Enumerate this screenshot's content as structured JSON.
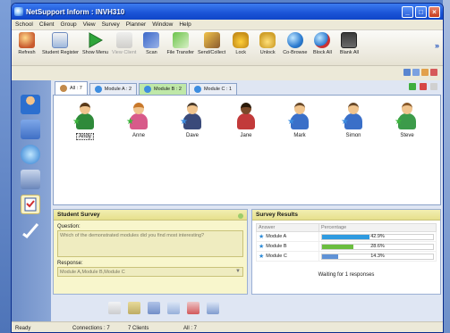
{
  "window": {
    "title": "NetSupport Inform : INVH310",
    "controls": {
      "minimize": "_",
      "maximize": "□",
      "close": "×"
    }
  },
  "menu": [
    "School",
    "Client",
    "Group",
    "View",
    "Survey",
    "Planner",
    "Window",
    "Help"
  ],
  "toolbar": {
    "buttons": [
      {
        "label": "Refresh",
        "icon": "refresh-icon",
        "disabled": false
      },
      {
        "label": "Student Register",
        "icon": "student-register-icon",
        "disabled": false
      },
      {
        "label": "Show Menu",
        "icon": "play-icon",
        "disabled": false
      },
      {
        "label": "View Client",
        "icon": "view-client-icon",
        "disabled": true
      },
      {
        "label": "Scan",
        "icon": "scan-icon",
        "disabled": false
      },
      {
        "label": "File Transfer",
        "icon": "file-transfer-icon",
        "disabled": false
      },
      {
        "label": "Send/Collect",
        "icon": "send-collect-icon",
        "disabled": false
      },
      {
        "label": "Lock",
        "icon": "lock-icon",
        "disabled": false
      },
      {
        "label": "Unlock",
        "icon": "unlock-icon",
        "disabled": false
      },
      {
        "label": "Co-Browse",
        "icon": "globe-icon",
        "disabled": false
      },
      {
        "label": "Block All",
        "icon": "block-all-icon",
        "disabled": false
      },
      {
        "label": "Blank All",
        "icon": "blank-all-icon",
        "disabled": false
      }
    ],
    "more": "»"
  },
  "tabs": [
    {
      "label": "All : 7",
      "active": true
    },
    {
      "label": "Module A : 2",
      "active": false
    },
    {
      "label": "Module B : 2",
      "active": false
    },
    {
      "label": "Module C : 1",
      "active": false
    }
  ],
  "students": [
    {
      "name": "Andy",
      "selected": true,
      "gender": "m"
    },
    {
      "name": "Anne",
      "selected": false,
      "gender": "f"
    },
    {
      "name": "Dave",
      "selected": false,
      "gender": "m"
    },
    {
      "name": "Jane",
      "selected": false,
      "gender": "f"
    },
    {
      "name": "Mark",
      "selected": false,
      "gender": "m"
    },
    {
      "name": "Simon",
      "selected": false,
      "gender": "m"
    },
    {
      "name": "Steve",
      "selected": false,
      "gender": "m"
    }
  ],
  "survey": {
    "title": "Student Survey",
    "question_label": "Question:",
    "question_text": "Which of the demonstrated modules did you find most interesting?",
    "response_label": "Response:",
    "response_value": "Module A,Module B,Module C"
  },
  "results": {
    "title": "Survey Results",
    "columns": [
      "Answer",
      "Percentage"
    ],
    "rows": [
      {
        "answer": "Module A",
        "percentage": "42.9%",
        "value": 42.9
      },
      {
        "answer": "Module B",
        "percentage": "28.6%",
        "value": 28.6
      },
      {
        "answer": "Module C",
        "percentage": "14.3%",
        "value": 14.3
      }
    ],
    "waiting": "Waiting for 1 responses"
  },
  "status": {
    "state": "Ready",
    "connections": "Connections : 7",
    "clients": "7 Clients",
    "all": "All : 7"
  },
  "colors": {
    "title_bar": "#1a53d6",
    "sidebar": "#7a98cf",
    "panel_yellow": "#f8f6cc",
    "bar_blue": "#2f9be0",
    "bar_green": "#6bbd3f"
  }
}
